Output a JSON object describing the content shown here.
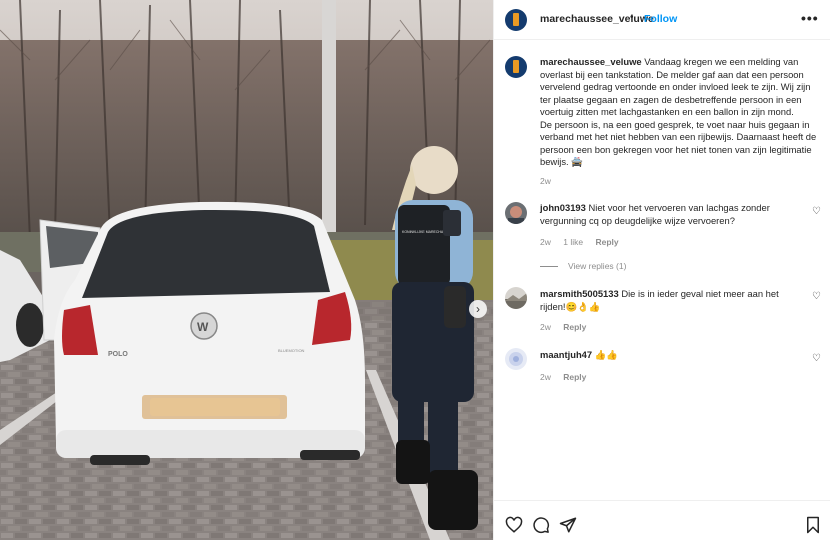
{
  "post": {
    "username": "marechaussee_veluwe",
    "separator": "•",
    "follow_label": "Follow",
    "more_label": "•••"
  },
  "caption": {
    "username": "marechaussee_veluwe",
    "text": "Vandaag kregen we een melding van overlast bij een tankstation. De melder gaf aan dat een persoon vervelend gedrag vertoonde en onder invloed leek te zijn. Wij zijn ter plaatse gegaan en zagen de desbetreffende persoon in een voertuig zitten met lachgastanken en een ballon in zijn mond.",
    "text2": "De persoon is, na een goed gesprek, te voet naar huis gegaan in verband met het niet hebben van een rijbewijs. Daarnaast heeft de persoon een bon gekregen voor het niet tonen van zijn legitimatie bewijs. 🚔",
    "time": "2w"
  },
  "comments": [
    {
      "username": "john03193",
      "text": "Niet voor het vervoeren van lachgas zonder vergunning cq op deugdelijke wijze vervoeren?",
      "time": "2w",
      "likes": "1 like",
      "reply": "Reply",
      "view_replies": "View replies (1)"
    },
    {
      "username": "marsmith5005133",
      "text": "Die is in ieder geval niet meer aan het rijden!😊👌👍",
      "time": "2w",
      "reply": "Reply"
    },
    {
      "username": "maantjuh47",
      "text": "👍👍",
      "time": "2w",
      "reply": "Reply"
    }
  ],
  "photo": {
    "car_badge": "POLO",
    "car_sub": "BLUEMOTION",
    "vest_text": "KONINKLIJKE MARECHAUSSEE",
    "carousel_next": "›"
  },
  "colors": {
    "link_blue": "#0095f6",
    "logo_navy": "#143b6e",
    "logo_orange": "#e99a24",
    "muted": "#8e8e8e"
  },
  "icons": [
    "heart-icon",
    "comment-icon",
    "share-icon",
    "bookmark-icon",
    "more-icon",
    "chevron-right-icon"
  ]
}
